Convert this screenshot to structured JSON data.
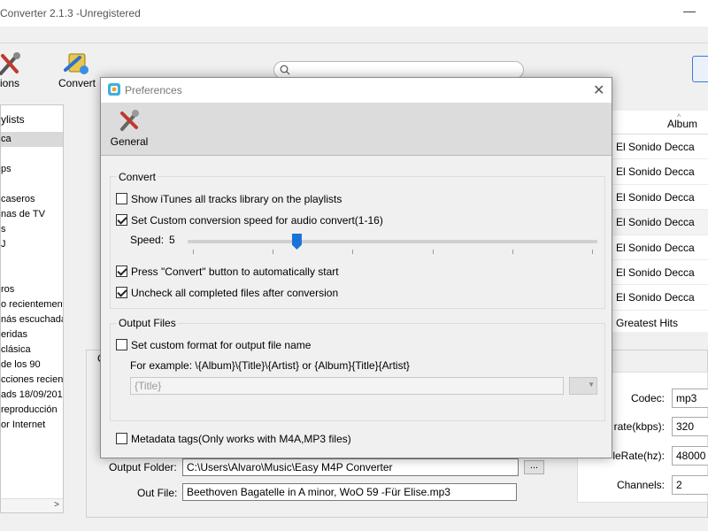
{
  "window": {
    "title": "Converter 2.1.3 -Unregistered",
    "minimize_glyph": "—"
  },
  "toolbar": {
    "options_label": "ions",
    "convert_label": "Convert",
    "search_placeholder": ""
  },
  "left_panel": {
    "header": "ylists",
    "items": [
      {
        "label": "ca",
        "selected": true
      },
      {
        "label": ""
      },
      {
        "label": "ps"
      },
      {
        "label": ""
      },
      {
        "label": "caseros"
      },
      {
        "label": "nas de TV"
      },
      {
        "label": "s"
      },
      {
        "label": "J"
      },
      {
        "label": ""
      },
      {
        "label": ""
      },
      {
        "label": "ros"
      },
      {
        "label": "o recientement"
      },
      {
        "label": "nás escuchadas"
      },
      {
        "label": "eridas"
      },
      {
        "label": "clásica"
      },
      {
        "label": "de los 90"
      },
      {
        "label": "cciones recien"
      },
      {
        "label": "ads 18/09/2013"
      },
      {
        "label": "reproducción"
      },
      {
        "label": "or Internet"
      }
    ]
  },
  "tracks": {
    "album_header": "Album",
    "rows": [
      "El Sonido Decca",
      "El Sonido Decca",
      "El Sonido Decca",
      "El Sonido Decca",
      "El Sonido Decca",
      "El Sonido Decca",
      "El Sonido Decca",
      "Greatest Hits"
    ]
  },
  "bottom": {
    "c_label": "C",
    "output_folder_label": "Output Folder:",
    "output_folder_value": "C:\\Users\\Alvaro\\Music\\Easy M4P Converter",
    "browse_label": "...",
    "out_file_label": "Out File:",
    "out_file_value": "Beethoven Bagatelle in A minor, WoO 59 -Für Elise.mp3",
    "codec_label": "Codec:",
    "codec_value": "mp3",
    "bitrate_label": "rate(kbps):",
    "bitrate_value": "320",
    "samplerate_label": "leRate(hz):",
    "samplerate_value": "48000",
    "channels_label": "Channels:",
    "channels_value": "2"
  },
  "dialog": {
    "title": "Preferences",
    "close_glyph": "✕",
    "tab_general": "General",
    "convert_group": {
      "title": "Convert",
      "show_itunes": {
        "label": "Show iTunes all tracks library on the playlists",
        "checked": false
      },
      "custom_speed": {
        "label": "Set Custom conversion speed for audio convert(1-16)",
        "checked": true
      },
      "speed_label": "Speed:",
      "speed_value": "5",
      "speed_min": 1,
      "speed_max": 16,
      "press_convert": {
        "label": "Press \"Convert\" button to automatically start",
        "checked": true
      },
      "uncheck_completed": {
        "label": "Uncheck all completed files after conversion",
        "checked": true
      }
    },
    "output_group": {
      "title": "Output Files",
      "custom_format": {
        "label": "Set custom format for output file name",
        "checked": false
      },
      "example": "For example: \\{Album}\\{Title}\\{Artist} or {Album}{Title}{Artist}",
      "format_placeholder": "{Title}"
    },
    "metadata_tags": {
      "label": "Metadata tags(Only works with M4A,MP3 files)",
      "checked": false
    }
  },
  "colors": {
    "accent": "#1a73d9",
    "window_bg": "#f0f0f0",
    "tab_strip_bg": "#dcdcdc"
  }
}
